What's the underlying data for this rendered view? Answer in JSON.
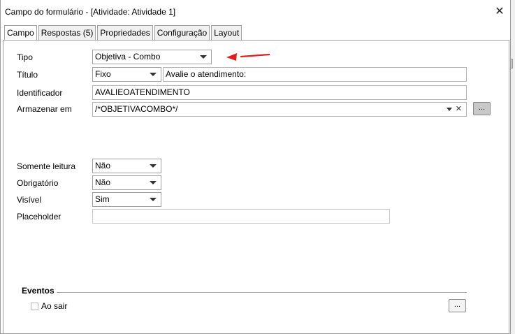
{
  "window": {
    "title": "Campo do formulário - [Atividade: Atividade 1]",
    "close_glyph": "✕"
  },
  "tabs": [
    {
      "label": "Campo",
      "active": true
    },
    {
      "label": "Respostas (5)",
      "active": false
    },
    {
      "label": "Propriedades",
      "active": false
    },
    {
      "label": "Configuração",
      "active": false
    },
    {
      "label": "Layout",
      "active": false
    }
  ],
  "form": {
    "tipo": {
      "label": "Tipo",
      "value": "Objetiva - Combo"
    },
    "titulo": {
      "label": "Título",
      "mode": "Fixo",
      "value": "Avalie o atendimento:"
    },
    "identificador": {
      "label": "Identificador",
      "value": "AVALIEOATENDIMENTO"
    },
    "armazenar": {
      "label": "Armazenar em",
      "value": "/*OBJETIVACOMBO*/",
      "clear_glyph": "✕",
      "button": "..."
    },
    "somente_leitura": {
      "label": "Somente leitura",
      "value": "Não"
    },
    "obrigatorio": {
      "label": "Obrigatório",
      "value": "Não"
    },
    "visivel": {
      "label": "Visível",
      "value": "Sim"
    },
    "placeholder": {
      "label": "Placeholder",
      "value": ""
    }
  },
  "eventos": {
    "title": "Eventos",
    "ao_sair": {
      "label": "Ao sair",
      "checked": false,
      "button": "..."
    }
  },
  "colors": {
    "annotation_arrow": "#e02020",
    "border": "#a0a0a0",
    "button_grey": "#c8c8c8"
  },
  "icons": {
    "close": "close-icon",
    "dropdown": "chevron-down-icon",
    "clear": "clear-icon",
    "annotation": "red-arrow-icon"
  }
}
